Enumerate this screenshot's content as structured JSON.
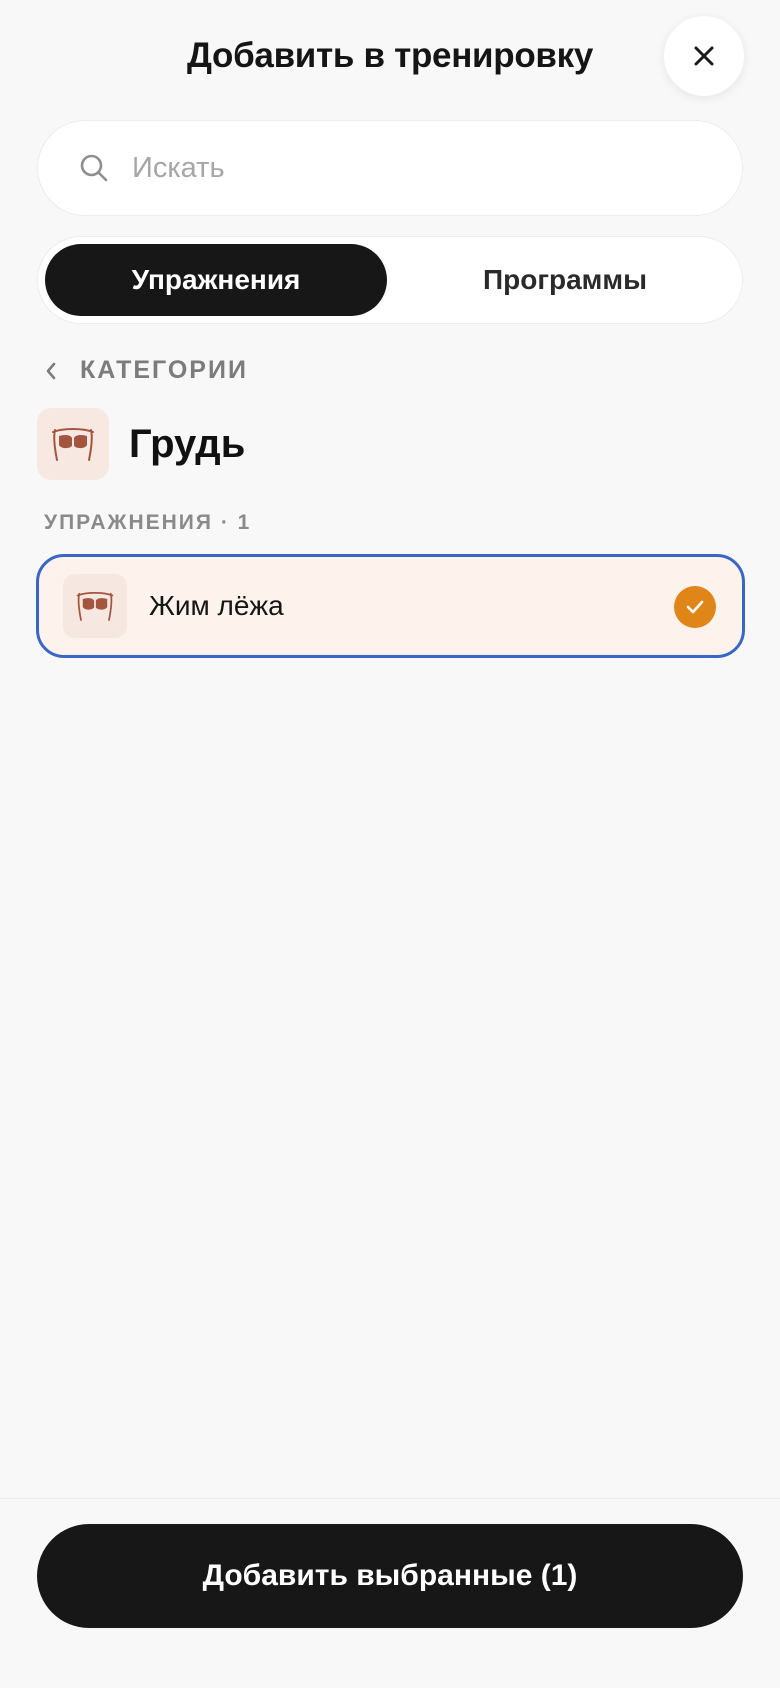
{
  "header": {
    "title": "Добавить в тренировку",
    "close_icon": "close-icon"
  },
  "search": {
    "placeholder": "Искать",
    "value": "",
    "icon": "search-icon"
  },
  "tabs": [
    {
      "label": "Упражнения",
      "active": true
    },
    {
      "label": "Программы",
      "active": false
    }
  ],
  "breadcrumb": {
    "label": "КАТЕГОРИИ",
    "icon": "chevron-left-icon"
  },
  "category": {
    "title": "Грудь",
    "icon": "chest-muscle-icon"
  },
  "exercises_section": {
    "label": "УПРАЖНЕНИЯ · 1",
    "items": [
      {
        "name": "Жим лёжа",
        "icon": "chest-muscle-icon",
        "selected": true
      }
    ]
  },
  "footer": {
    "add_button_label": "Добавить выбранные (1)"
  },
  "colors": {
    "primary_dark": "#171717",
    "accent_orange": "#e08619",
    "selection_border": "#3a66c6",
    "selected_bg": "#fdf3ec",
    "icon_tile_bg": "#f8e8e2",
    "muscle_color": "#a4553f"
  }
}
